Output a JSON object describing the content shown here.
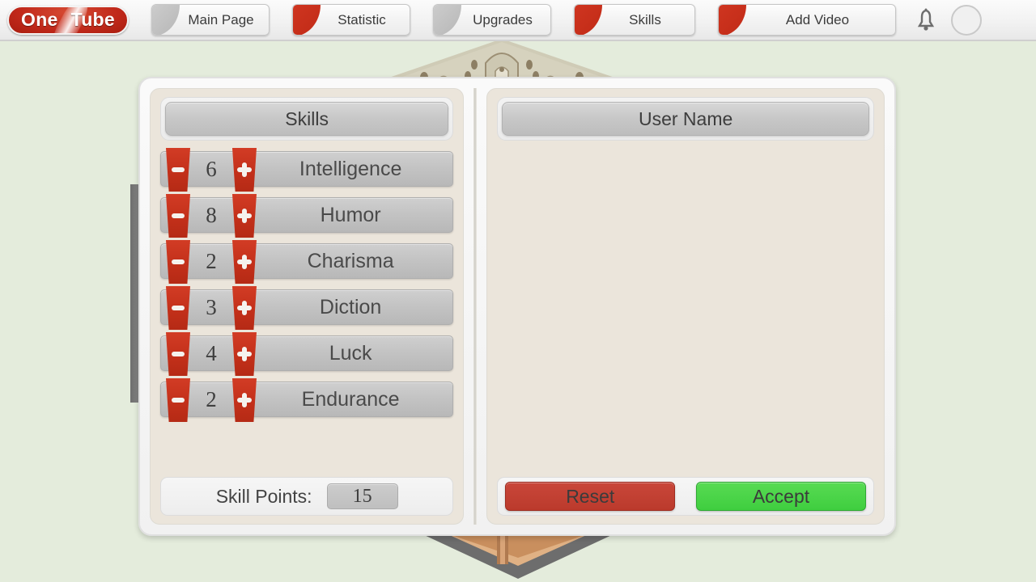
{
  "header": {
    "logo": {
      "word1": "One",
      "word2": "Tube",
      "brand_color": "#c0281a"
    },
    "tabs": [
      {
        "label": "Main Page",
        "corner": "gray"
      },
      {
        "label": "Statistic",
        "corner": "red"
      },
      {
        "label": "Upgrades",
        "corner": "gray"
      },
      {
        "label": "Skills",
        "corner": "red"
      },
      {
        "label": "Add Video",
        "corner": "red"
      }
    ],
    "bell_icon": "bell-icon",
    "avatar_icon": "avatar-placeholder"
  },
  "left_panel": {
    "title": "Skills",
    "skills": [
      {
        "name": "Intelligence",
        "value": "6"
      },
      {
        "name": "Humor",
        "value": "8"
      },
      {
        "name": "Charisma",
        "value": "2"
      },
      {
        "name": "Diction",
        "value": "3"
      },
      {
        "name": "Luck",
        "value": "4"
      },
      {
        "name": "Endurance",
        "value": "2"
      }
    ],
    "skill_points_label": "Skill Points:",
    "skill_points_value": "15",
    "decrement_icon": "minus-icon",
    "increment_icon": "plus-icon"
  },
  "right_panel": {
    "title": "User Name",
    "reset_label": "Reset",
    "accept_label": "Accept",
    "reset_color": "#bb3a2c",
    "accept_color": "#3fce3f"
  }
}
